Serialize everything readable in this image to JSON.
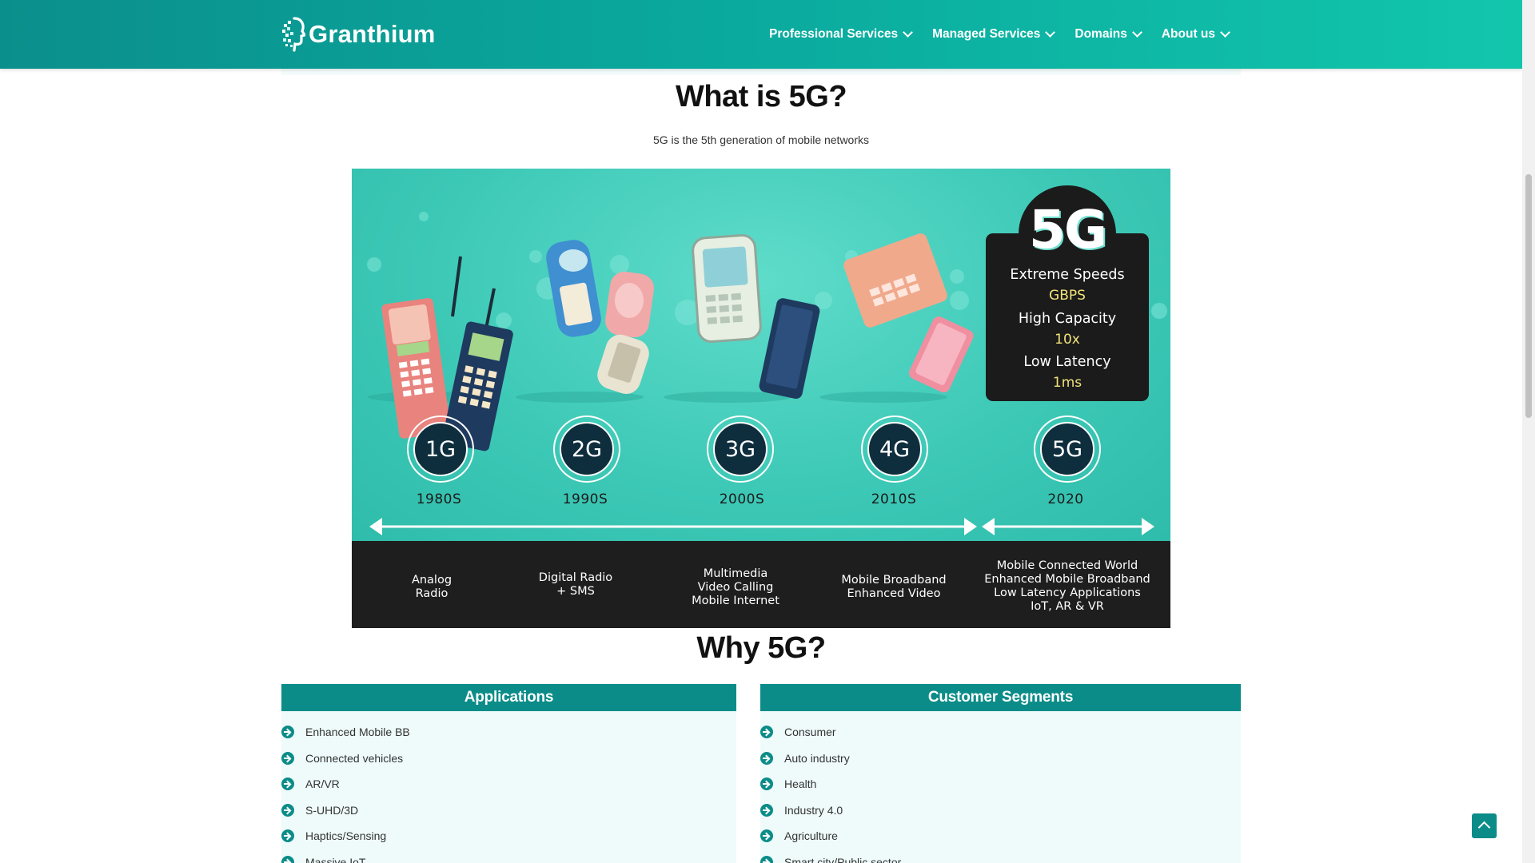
{
  "header": {
    "brand": "Granthium",
    "nav": [
      {
        "label": "Professional Services"
      },
      {
        "label": "Managed Services"
      },
      {
        "label": "Domains"
      },
      {
        "label": "About us"
      }
    ]
  },
  "intro": {
    "title": "What is 5G?",
    "subtitle": "5G is the 5th generation of mobile networks"
  },
  "infographic": {
    "generations": [
      {
        "gen": "1G",
        "era": "1980S",
        "desc": [
          "Analog",
          "Radio"
        ]
      },
      {
        "gen": "2G",
        "era": "1990S",
        "desc": [
          "Digital Radio",
          "+ SMS"
        ]
      },
      {
        "gen": "3G",
        "era": "2000S",
        "desc": [
          "Multimedia",
          "Video Calling",
          "Mobile Internet"
        ]
      },
      {
        "gen": "4G",
        "era": "2010S",
        "desc": [
          "Mobile Broadband",
          "Enhanced Video"
        ]
      },
      {
        "gen": "5G",
        "era": "2020",
        "desc": [
          "Mobile Connected World",
          "Enhanced Mobile Broadband",
          "Low Latency Applications",
          "IoT, AR & VR"
        ]
      }
    ],
    "highlight": {
      "logo": "5G",
      "features": [
        {
          "name": "Extreme Speeds",
          "value": "GBPS"
        },
        {
          "name": "High Capacity",
          "value": "10x"
        },
        {
          "name": "Low Latency",
          "value": "1ms"
        }
      ]
    }
  },
  "why": {
    "title": "Why 5G?",
    "applications": {
      "heading": "Applications",
      "items": [
        "Enhanced Mobile BB",
        "Connected vehicles",
        "AR/VR",
        "S-UHD/3D",
        "Haptics/Sensing",
        "Massive IoT"
      ]
    },
    "segments": {
      "heading": "Customer Segments",
      "items": [
        "Consumer",
        "Auto industry",
        "Health",
        "Industry 4.0",
        "Agriculture",
        "Smart city/Public sector"
      ]
    },
    "colors": {
      "accent": "#0b8c89",
      "panel_bg": "#effbfb",
      "infographic_bg": "#3ec9b7"
    }
  }
}
